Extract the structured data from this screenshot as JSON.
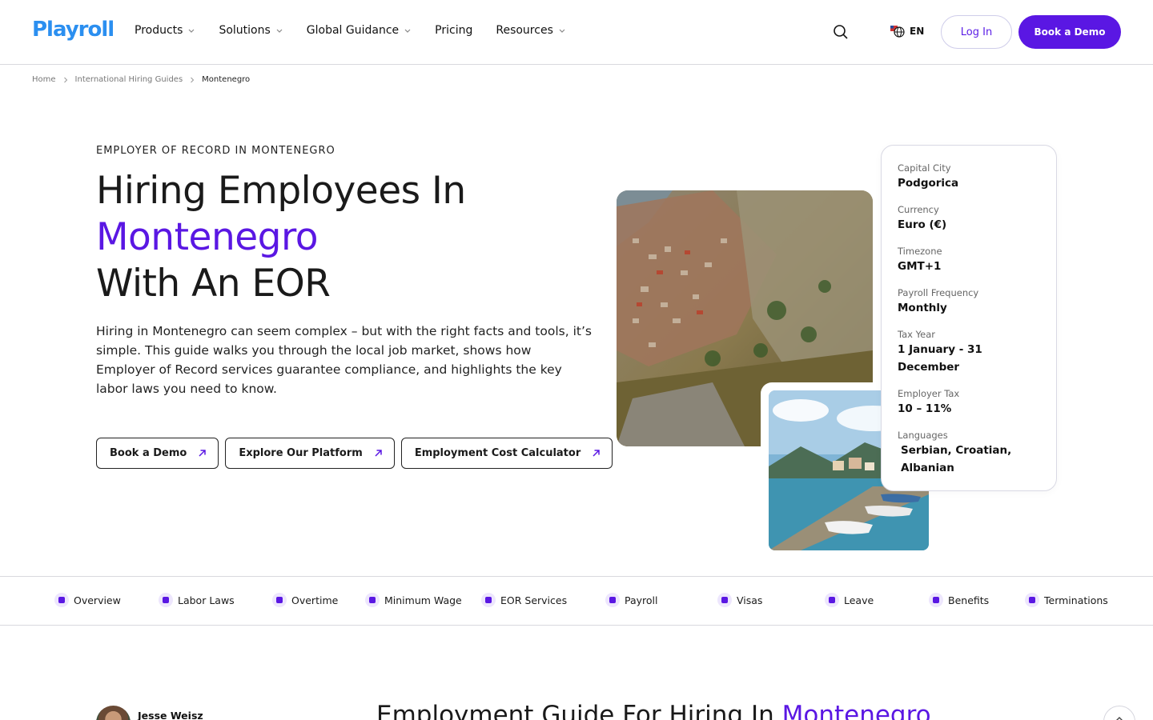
{
  "header": {
    "logo": "Playroll",
    "nav": [
      {
        "label": "Products",
        "dropdown": true
      },
      {
        "label": "Solutions",
        "dropdown": true
      },
      {
        "label": "Global Guidance",
        "dropdown": true
      },
      {
        "label": "Pricing",
        "dropdown": false
      },
      {
        "label": "Resources",
        "dropdown": true
      }
    ],
    "language": "EN",
    "login_label": "Log In",
    "demo_label": "Book a Demo"
  },
  "breadcrumb": [
    "Home",
    "International Hiring Guides",
    "Montenegro"
  ],
  "hero": {
    "eyebrow": "EMPLOYER OF RECORD IN MONTENEGRO",
    "title_line1": "Hiring Employees In",
    "title_accent": "Montenegro",
    "title_line3": "With An EOR",
    "description": "Hiring in Montenegro can seem complex – but with the right facts and tools, it’s simple. This guide walks you through the local job market, shows how Employer of Record services guarantee compliance, and highlights the key labor laws you need to know.",
    "ctas": [
      "Book a Demo",
      "Explore Our Platform",
      "Employment Cost Calculator"
    ]
  },
  "facts": [
    {
      "label": "Capital City",
      "value": "Podgorica"
    },
    {
      "label": "Currency",
      "value": "Euro (€)"
    },
    {
      "label": "Timezone",
      "value": "GMT+1"
    },
    {
      "label": "Payroll Frequency",
      "value": "Monthly"
    },
    {
      "label": "Tax Year",
      "value": "1 January - 31 December"
    },
    {
      "label": "Employer Tax",
      "value": "10 – 11%"
    },
    {
      "label": "Languages",
      "value": "Serbian, Croatian, Albanian"
    }
  ],
  "section_nav": [
    "Overview",
    "Labor Laws",
    "Overtime",
    "Minimum Wage",
    "EOR Services",
    "Payroll",
    "Visas",
    "Leave",
    "Benefits",
    "Terminations"
  ],
  "author": {
    "name": "Jesse Weisz"
  },
  "guide": {
    "title_prefix": "Employment Guide For Hiring In",
    "title_accent": "Montenegro"
  },
  "colors": {
    "accent": "#5a17e3",
    "logo": "#2b8ff0",
    "border": "#d9d9de"
  },
  "icons": {
    "search": "search-icon",
    "globe": "globe-icon",
    "chevron": "chevron-down-icon",
    "arrow": "arrow-up-right-icon",
    "scroll_top": "chevron-up-icon"
  }
}
